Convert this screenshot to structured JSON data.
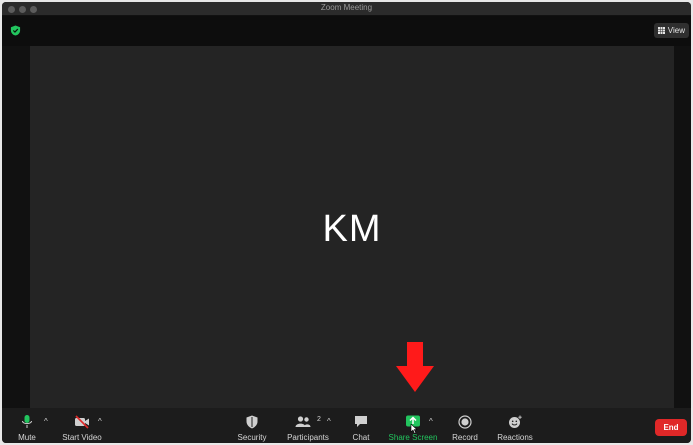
{
  "window": {
    "title": "Zoom Meeting"
  },
  "topbar": {
    "view_label": "View"
  },
  "video": {
    "participant_initials": "KM"
  },
  "toolbar": {
    "mute": "Mute",
    "start_video": "Start Video",
    "security": "Security",
    "participants": "Participants",
    "participants_count": "2",
    "chat": "Chat",
    "share_screen": "Share Screen",
    "record": "Record",
    "reactions": "Reactions",
    "end": "End"
  },
  "colors": {
    "accent_green": "#22c55e",
    "end_red": "#e02828",
    "arrow_red": "#ff1a1a"
  }
}
